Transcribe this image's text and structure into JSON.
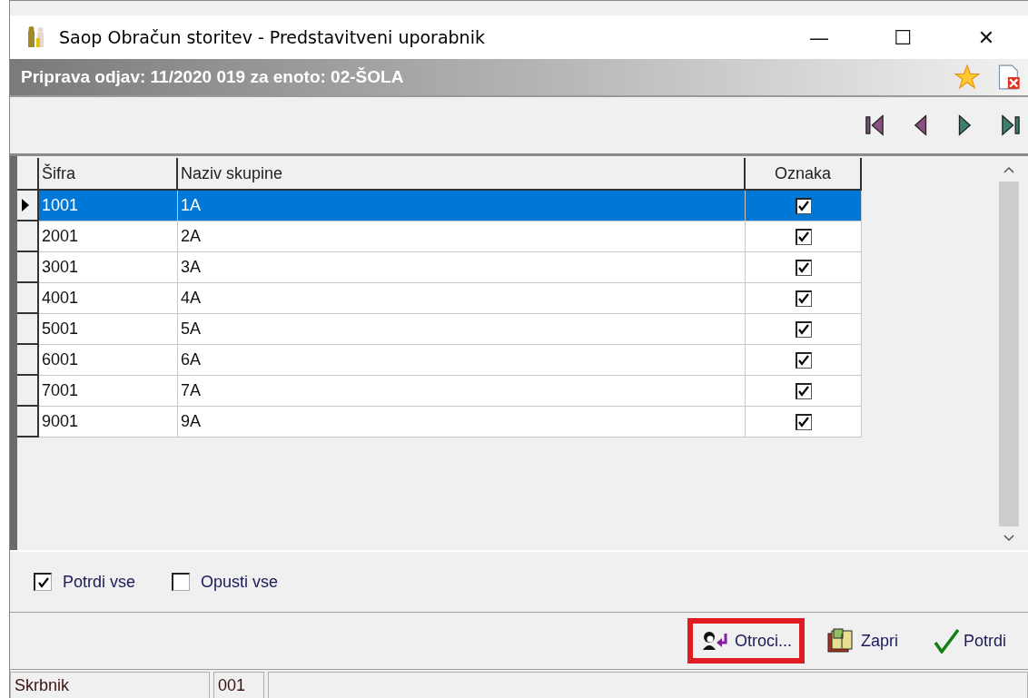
{
  "window": {
    "title": "Saop Obračun storitev - Predstavitveni uporabnik",
    "controls": [
      "—",
      "☐",
      "✕"
    ]
  },
  "header": {
    "title": "Priprava odjav: 11/2020 019 za enoto: 02-ŠOLA"
  },
  "table": {
    "columns": [
      "Šifra",
      "Naziv skupine",
      "Oznaka"
    ],
    "rows": [
      {
        "code": "1001",
        "name": "1A",
        "checked": true,
        "selected": true
      },
      {
        "code": "2001",
        "name": "2A",
        "checked": true,
        "selected": false
      },
      {
        "code": "3001",
        "name": "3A",
        "checked": true,
        "selected": false
      },
      {
        "code": "4001",
        "name": "4A",
        "checked": true,
        "selected": false
      },
      {
        "code": "5001",
        "name": "5A",
        "checked": true,
        "selected": false
      },
      {
        "code": "6001",
        "name": "6A",
        "checked": true,
        "selected": false
      },
      {
        "code": "7001",
        "name": "7A",
        "checked": true,
        "selected": false
      },
      {
        "code": "9001",
        "name": "9A",
        "checked": true,
        "selected": false
      }
    ]
  },
  "options": [
    {
      "label": "Potrdi vse",
      "checked": true
    },
    {
      "label": "Opusti vse",
      "checked": false
    }
  ],
  "buttons": [
    {
      "label": "Otroci...",
      "kind": "children",
      "highlighted": true
    },
    {
      "label": "Zapri",
      "kind": "close",
      "highlighted": false
    },
    {
      "label": "Potrdi",
      "kind": "confirm",
      "highlighted": false
    }
  ],
  "status_bar": [
    "Skrbnik",
    "001"
  ]
}
